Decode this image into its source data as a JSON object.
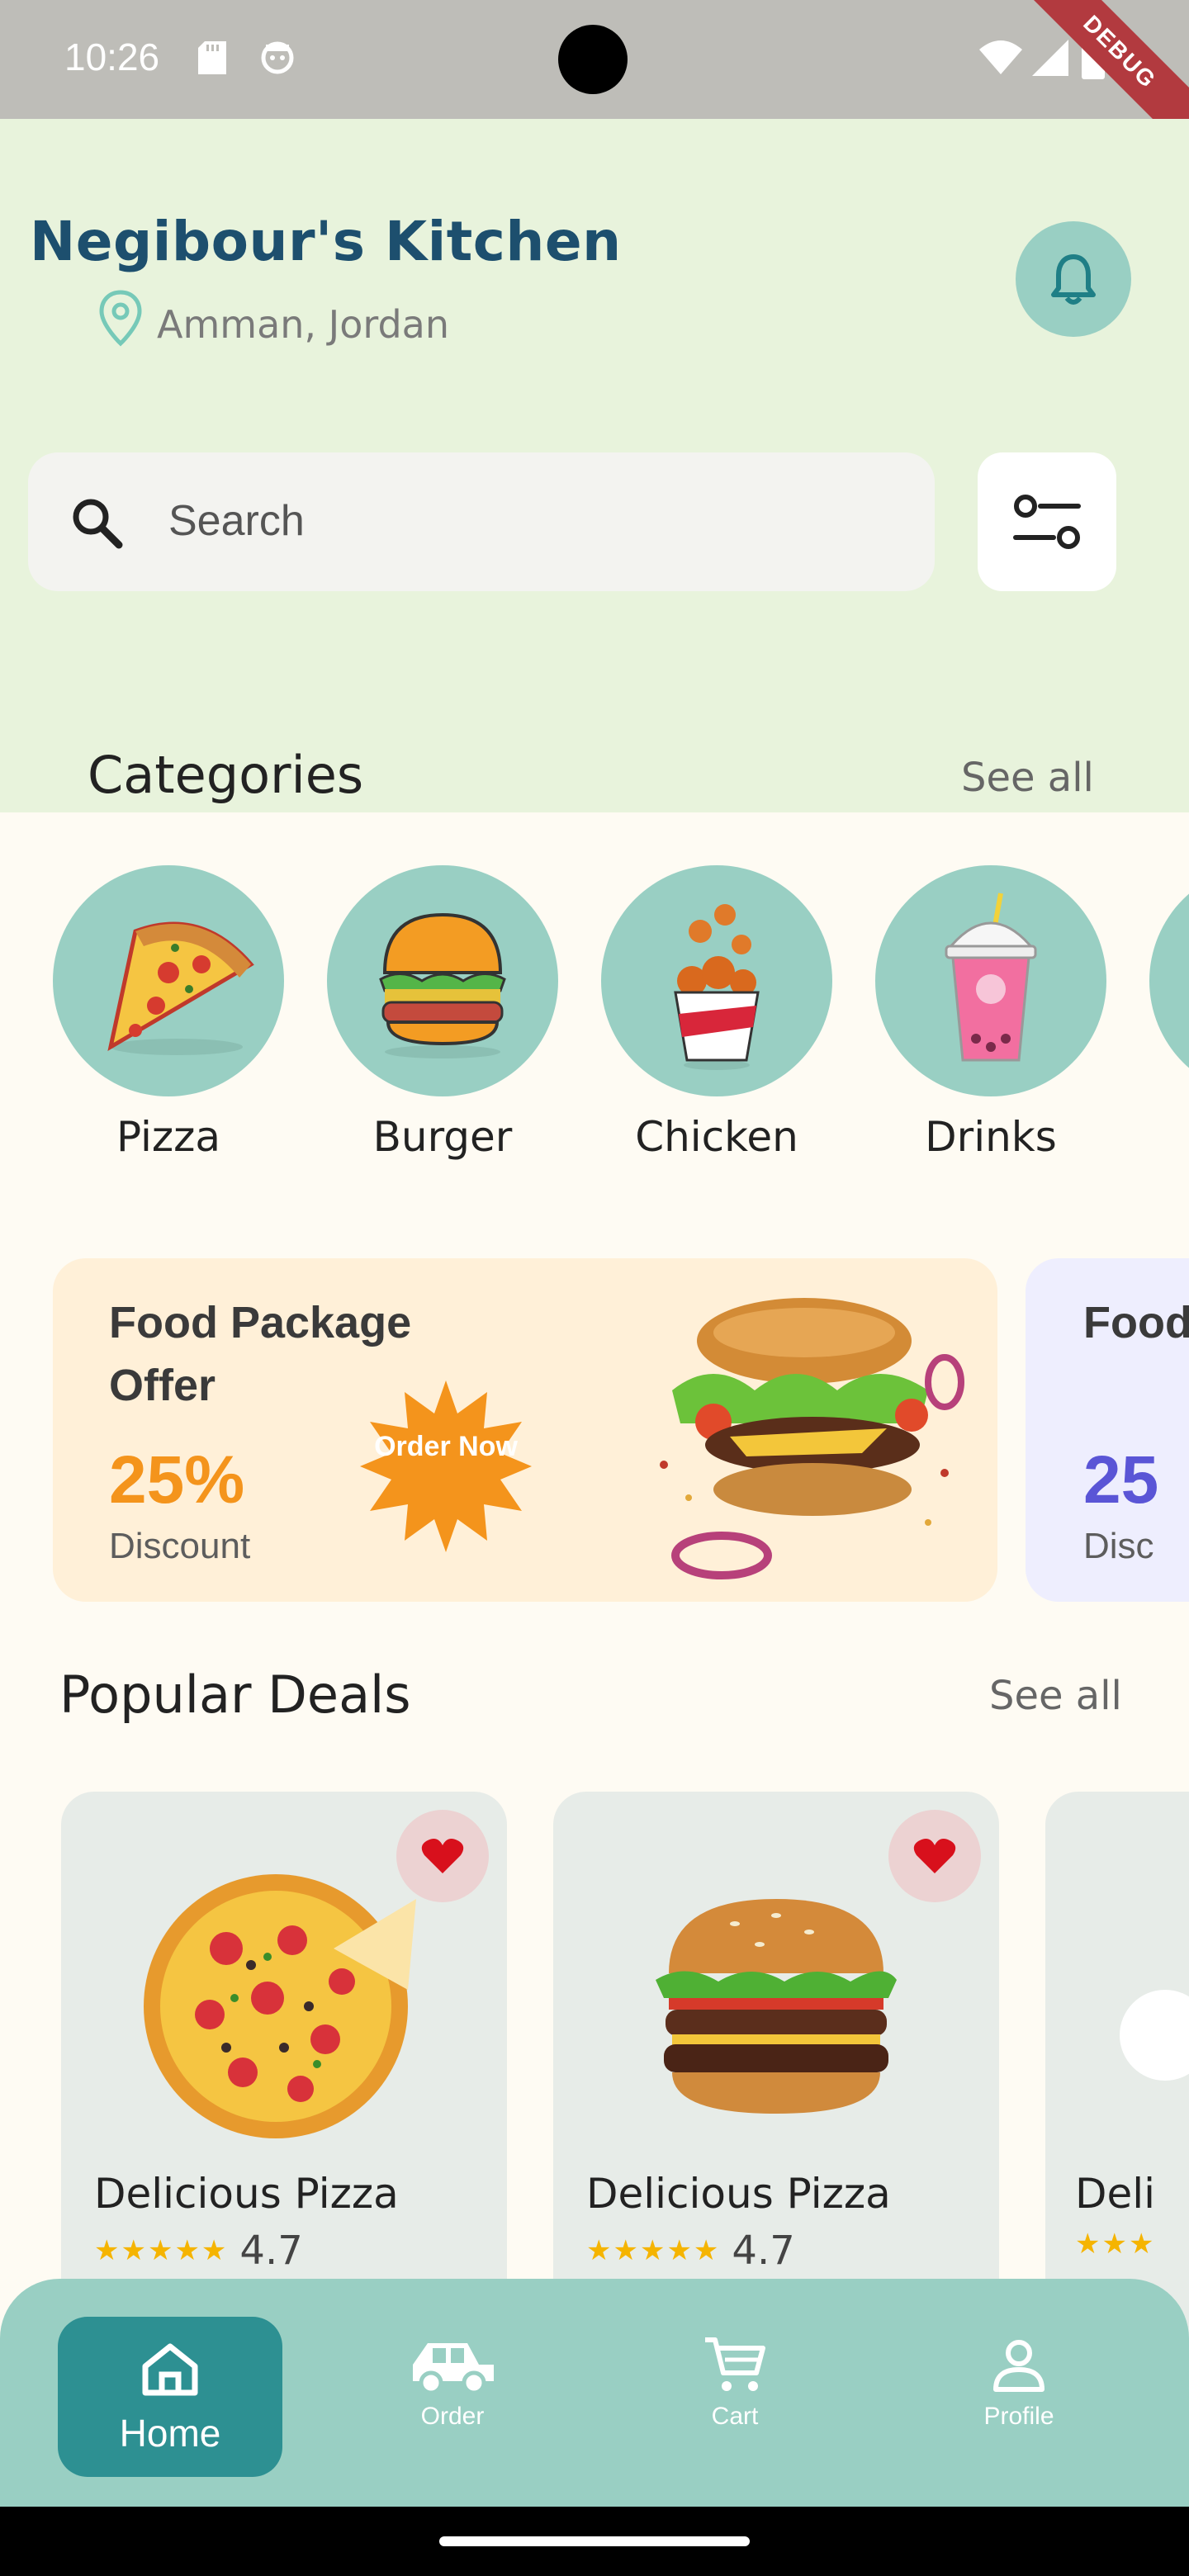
{
  "status_bar": {
    "time": "10:26",
    "debug_label": "DEBUG"
  },
  "header": {
    "title": "Negibour's Kitchen",
    "location": "Amman, Jordan"
  },
  "search": {
    "placeholder": "Search"
  },
  "categories": {
    "title": "Categories",
    "see_all": "See all",
    "items": [
      {
        "label": "Pizza"
      },
      {
        "label": "Burger"
      },
      {
        "label": "Chicken"
      },
      {
        "label": "Drinks"
      }
    ]
  },
  "banners": [
    {
      "title": "Food Package Offer",
      "percent": "25%",
      "discount": "Discount",
      "cta": "Order Now"
    },
    {
      "title": "Food Offer",
      "percent": "25",
      "discount": "Disc"
    }
  ],
  "popular": {
    "title": "Popular Deals",
    "see_all": "See all",
    "items": [
      {
        "name": "Delicious Pizza",
        "rating": "4.7"
      },
      {
        "name": "Delicious Pizza",
        "rating": "4.7"
      },
      {
        "name": "Deli",
        "rating": ""
      }
    ]
  },
  "nav": {
    "home": "Home",
    "order": "Order",
    "cart": "Cart",
    "profile": "Profile"
  },
  "colors": {
    "header_bg": "#e8f3dc",
    "accent": "#99cfc3",
    "nav_active": "#2d9092",
    "title": "#1d4f6e",
    "offer_orange": "#f4941c"
  }
}
